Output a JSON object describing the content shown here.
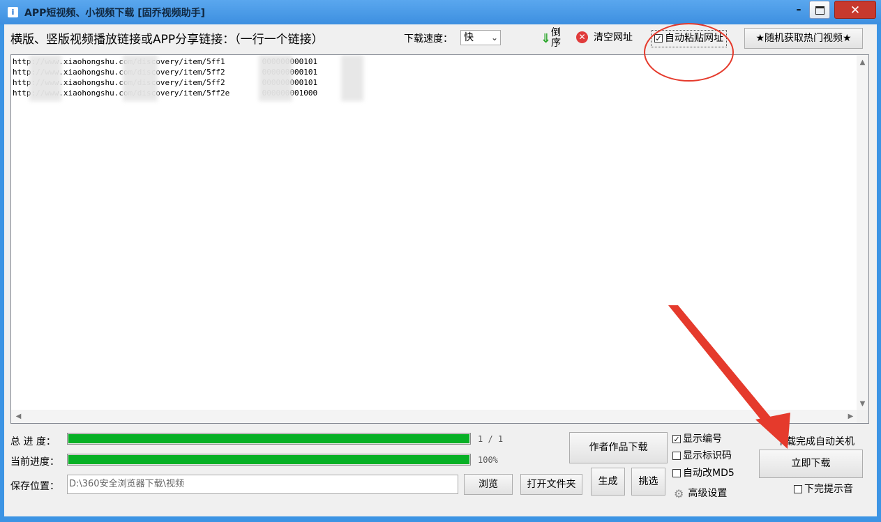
{
  "window": {
    "title": "APP短视频、小视频下载 [固乔视频助手]",
    "app_icon_glyph": "i",
    "min_glyph": "–",
    "close_glyph": "✕"
  },
  "toolbar": {
    "input_label": "横版、竖版视频播放链接或APP分享链接：（一行一个链接）",
    "speed_label": "下载速度：",
    "speed_value": "快",
    "reverse_label": "倒序",
    "clear_label": "清空网址",
    "auto_paste_label": "自动粘贴网址",
    "auto_paste_checked": true,
    "hot_video_label": "★随机获取热门视频★"
  },
  "urls": [
    "http://www.xiaohongshu.com/discovery/item/5ff1        000000000101",
    "http://www.xiaohongshu.com/discovery/item/5ff2        000000000101",
    "http://www.xiaohongshu.com/discovery/item/5ff2        000000000101",
    "http://www.xiaohongshu.com/discovery/item/5ff2e       000000001000"
  ],
  "progress": {
    "total_label": "总 进 度：",
    "total_text": "1 / 1",
    "total_fraction": 1.0,
    "current_label": "当前进度：",
    "current_text": "100%",
    "current_fraction": 1.0
  },
  "save": {
    "label": "保存位置：",
    "path": "D:\\360安全浏览器下载\\视频",
    "browse_label": "浏览",
    "open_folder_label": "打开文件夹",
    "generate_label": "生成",
    "pick_label": "挑选"
  },
  "author_download_label": "作者作品下载",
  "options": {
    "show_number": "显示编号",
    "show_number_checked": true,
    "show_id": "显示标识码",
    "show_id_checked": false,
    "auto_md5": "自动改MD5",
    "auto_md5_checked": false,
    "advanced": "高级设置"
  },
  "right": {
    "auto_shutdown": "下载完成自动关机",
    "download_now": "立即下载",
    "done_sound": "下完提示音",
    "done_sound_checked": false
  },
  "annotation_color": "#e53a2c",
  "progress_color": "#06b025"
}
